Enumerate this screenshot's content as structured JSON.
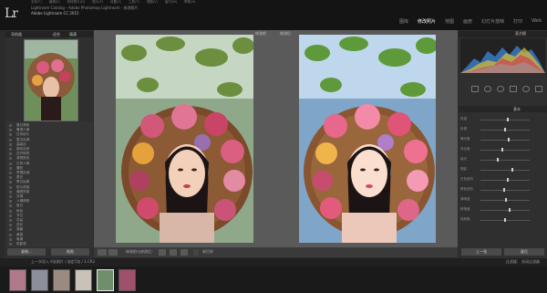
{
  "app": {
    "logo": "Lr",
    "catalog_title": "Lightroom Catalog - Adobe Photoshop Lightroom - 修改照片",
    "identity_plate": "Adobe Lightroom CC 2015"
  },
  "menu": [
    "文件(F)",
    "编辑(E)",
    "修改照片(D)",
    "照片(P)",
    "设置(S)",
    "工具(T)",
    "视图(V)",
    "窗口(W)",
    "帮助(H)"
  ],
  "modules": [
    {
      "label": "图库",
      "active": false
    },
    {
      "label": "修改照片",
      "active": true
    },
    {
      "label": "地图",
      "active": false
    },
    {
      "label": "画册",
      "active": false
    },
    {
      "label": "幻灯片放映",
      "active": false
    },
    {
      "label": "打印",
      "active": false
    },
    {
      "label": "Web",
      "active": false
    }
  ],
  "left_panel": {
    "navigator_label": "导航器",
    "navigator_fit": "适合",
    "navigator_fill": "填满",
    "presets": [
      "春日清新",
      "暖调人像",
      "日系胶片",
      "复古色调",
      "高级灰",
      "森系自然",
      "花卉明亮",
      "清透肤色",
      "古风人像",
      "暖阳",
      "青橙色调",
      "柔光",
      "黑白经典",
      "胶片质感",
      "通透亮丽",
      "冷调",
      "人像精修",
      "夏日",
      "秋色",
      "节日",
      "花朵",
      "逆光",
      "清晨",
      "黄昏",
      "暗调",
      "电影感"
    ],
    "buttons": {
      "copy": "复制...",
      "paste": "粘贴"
    }
  },
  "center": {
    "before_label": "修改前",
    "after_label": "修改后"
  },
  "toolbar": {
    "view_mode": "修改前与修改后：",
    "soft_proof": "软打样"
  },
  "right_panel": {
    "histogram_label": "直方图",
    "basic_label": "基本",
    "sliders": [
      {
        "label": "色温",
        "value": 0.55
      },
      {
        "label": "色调",
        "value": 0.5
      },
      {
        "label": "曝光度",
        "value": 0.58
      },
      {
        "label": "对比度",
        "value": 0.45
      },
      {
        "label": "高光",
        "value": 0.35
      },
      {
        "label": "阴影",
        "value": 0.65
      },
      {
        "label": "白色色阶",
        "value": 0.55
      },
      {
        "label": "黑色色阶",
        "value": 0.48
      },
      {
        "label": "清晰度",
        "value": 0.52
      },
      {
        "label": "鲜艳度",
        "value": 0.6
      },
      {
        "label": "饱和度",
        "value": 0.5
      }
    ],
    "buttons": {
      "previous": "上一张",
      "reset": "复位"
    }
  },
  "filmstrip": {
    "info": "上一次导入  6张照片 / 选定1张 / 1.CR2",
    "filter": "过滤器：  关闭过滤器",
    "selected_index": 4,
    "count": 6
  },
  "colors": {
    "accent": "#ffffff",
    "panel": "#2f2f2f",
    "background": "#5a5a5a"
  }
}
